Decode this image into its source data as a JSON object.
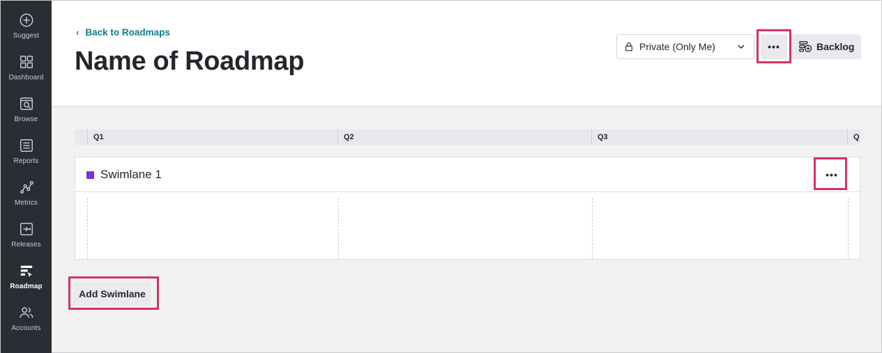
{
  "sidebar": {
    "items": [
      {
        "label": "Suggest",
        "icon": "plus-circle-icon"
      },
      {
        "label": "Dashboard",
        "icon": "grid-icon"
      },
      {
        "label": "Browse",
        "icon": "search-doc-icon"
      },
      {
        "label": "Reports",
        "icon": "list-doc-icon"
      },
      {
        "label": "Metrics",
        "icon": "nodes-icon"
      },
      {
        "label": "Releases",
        "icon": "release-icon"
      },
      {
        "label": "Roadmap",
        "icon": "roadmap-icon",
        "active": true
      },
      {
        "label": "Accounts",
        "icon": "users-icon"
      }
    ]
  },
  "header": {
    "back_label": "Back to Roadmaps",
    "title": "Name of Roadmap",
    "visibility_label": "Private (Only Me)",
    "more_label": "•••",
    "backlog_label": "Backlog"
  },
  "timeline": {
    "quarters": [
      "Q1",
      "Q2",
      "Q3",
      "Q"
    ]
  },
  "swimlane": {
    "name": "Swimlane 1",
    "color": "#7b2ee0",
    "more_label": "•••"
  },
  "actions": {
    "add_swimlane_label": "Add Swimlane"
  },
  "colors": {
    "accent_link": "#0e7c8a",
    "highlight": "#d7315f",
    "sidebar_bg": "#2b2d35"
  }
}
